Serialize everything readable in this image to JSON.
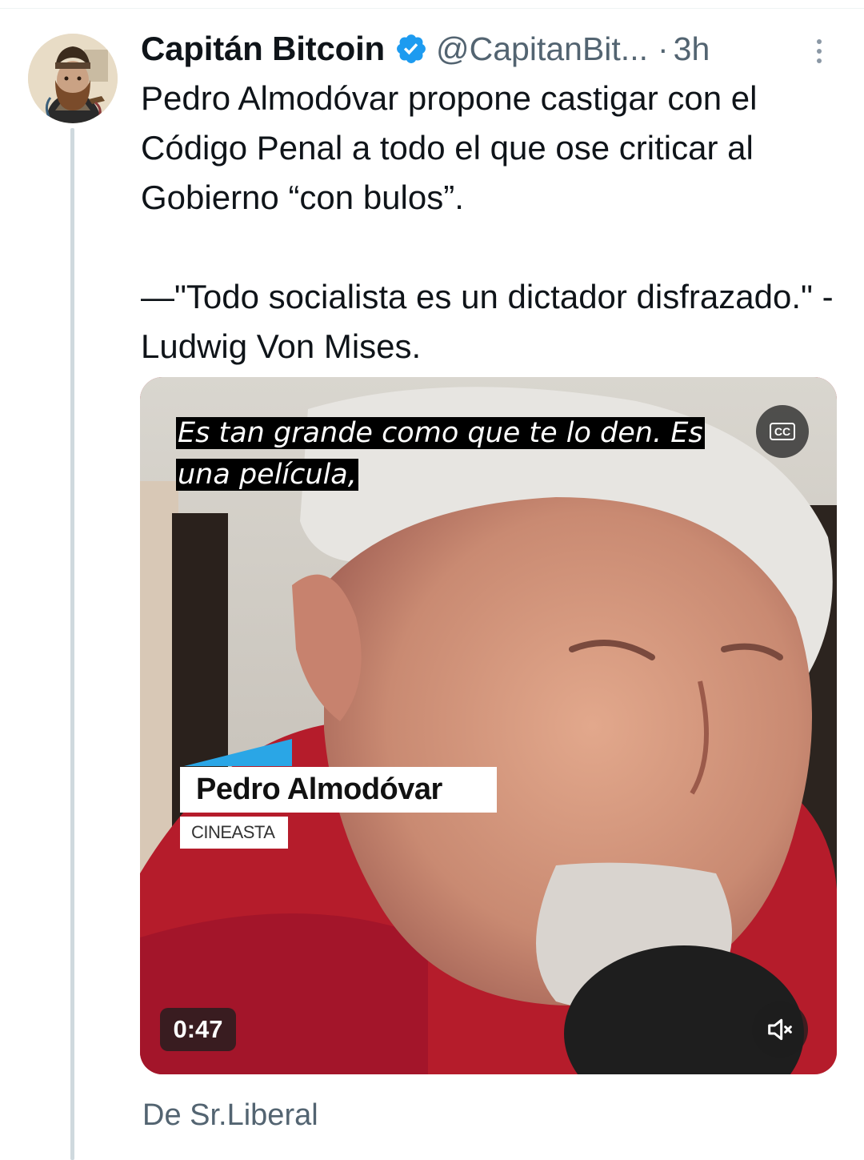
{
  "tweet": {
    "author": {
      "display_name": "Capitán Bitcoin",
      "handle": "@CapitanBit...",
      "verified": true,
      "avatar_icon": "avatar-bearded-man"
    },
    "separator": "·",
    "time": "3h",
    "text_lines": [
      "Pedro Almodóvar propone castigar con el Código Penal a todo el que ose criticar al Gobierno “con bulos”.",
      "—\"Todo socialista es un dictador disfrazado.\" - Ludwig Von Mises."
    ],
    "media": {
      "type": "video",
      "caption": "Es tan grande como que te lo den. Es una película,",
      "cc_label": "CC",
      "lower_third_name": "Pedro Almodóvar",
      "lower_third_role": "CINEASTA",
      "duration": "0:47",
      "muted": true
    },
    "source": "De Sr.Liberal"
  },
  "icons": {
    "verified": "verified-badge-icon",
    "more": "more-vertical-icon",
    "mute": "speaker-muted-icon",
    "cc": "closed-captions-icon"
  },
  "colors": {
    "verified_blue": "#1d9bf0",
    "secondary_text": "#536471",
    "thread_line": "#cfd9de",
    "lower_third_accent": "#2aa6e6"
  }
}
